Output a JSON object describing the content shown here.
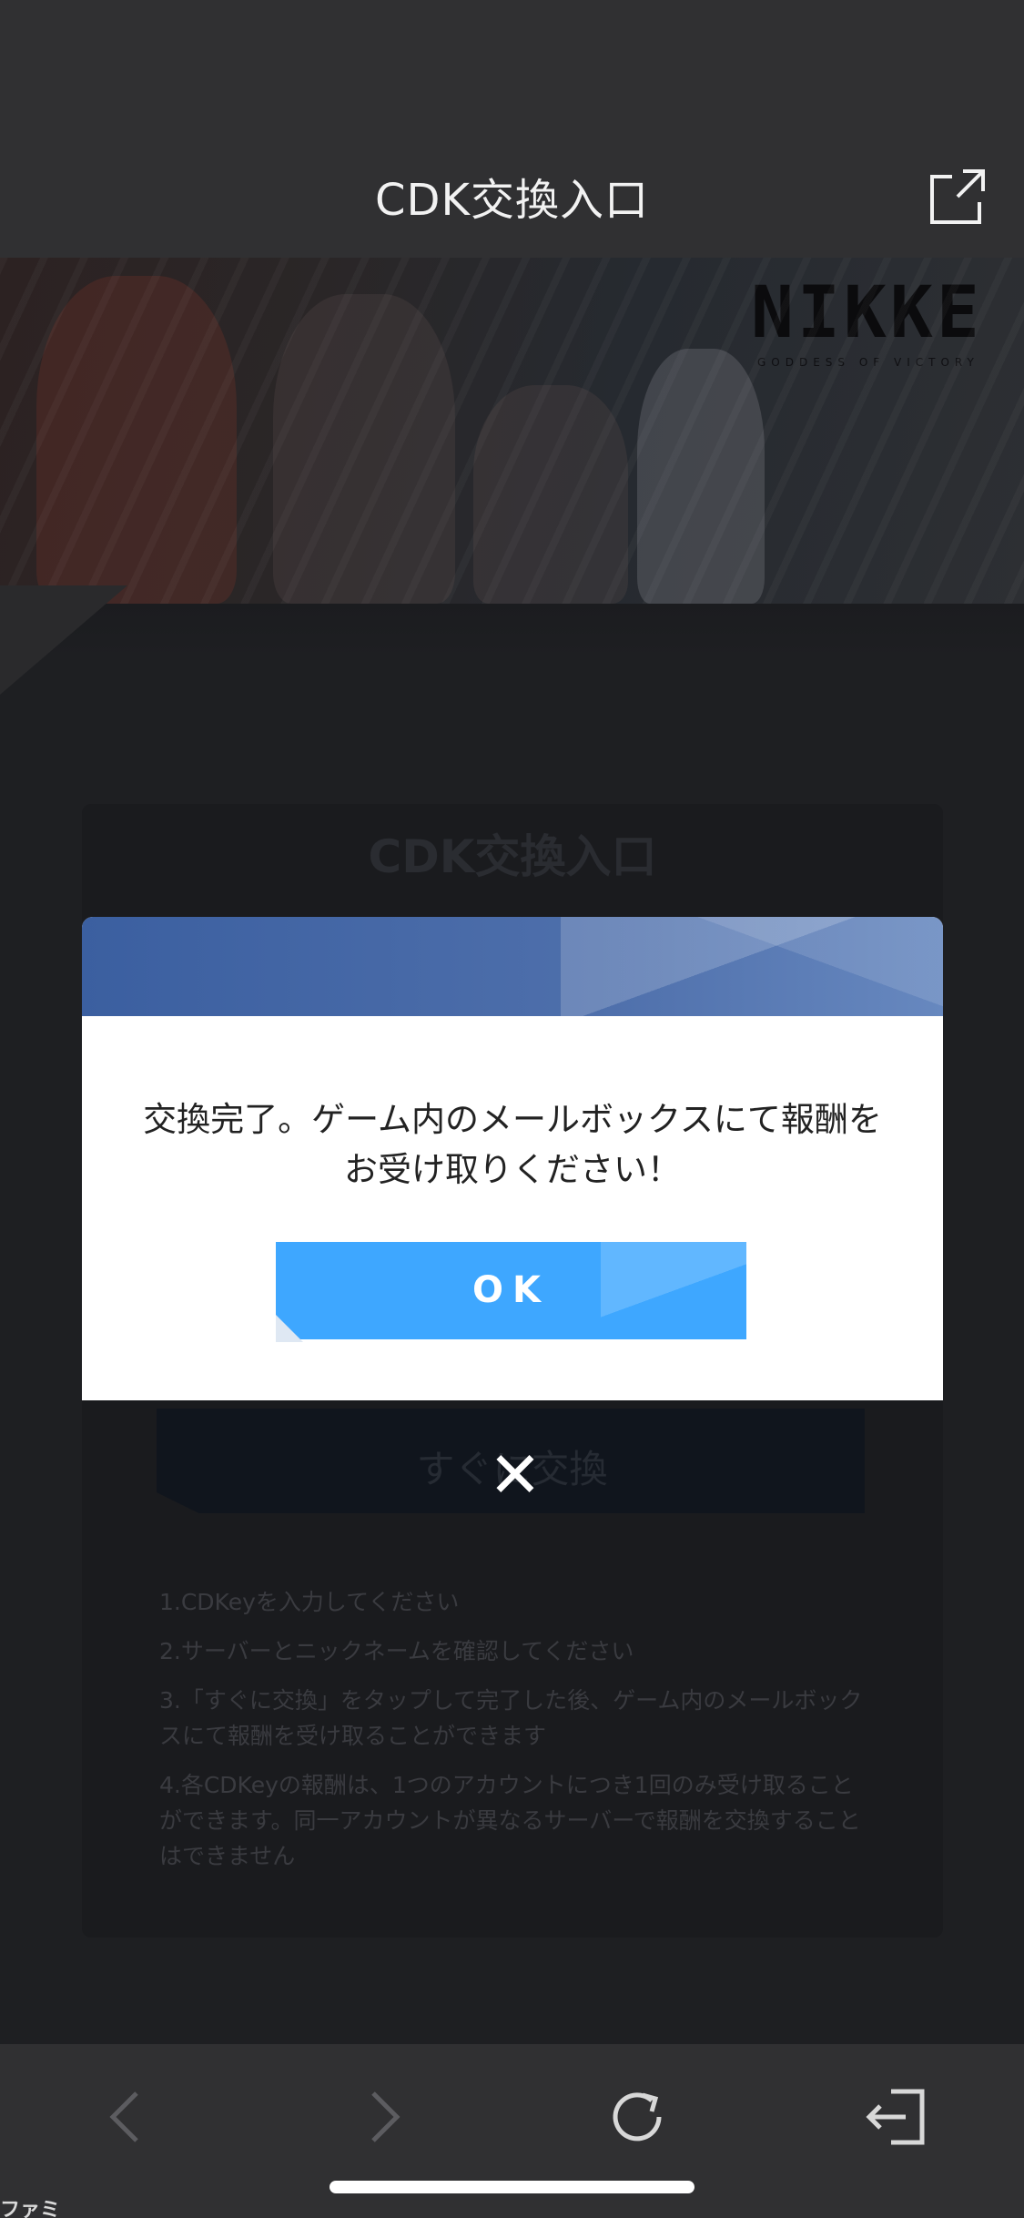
{
  "topbar": {
    "title": "CDK交換入口"
  },
  "banner": {
    "logo": "NIKKE",
    "logo_sub": "GODDESS OF VICTORY"
  },
  "card": {
    "title": "CDK交換入口",
    "exchange_button": "すぐに交換",
    "instructions": [
      "1.CDKeyを入力してください",
      "2.サーバーとニックネームを確認してください",
      "3.「すぐに交換」をタップして完了した後、ゲーム内のメールボックスにて報酬を受け取ることができます",
      "4.各CDKeyの報酬は、1つのアカウントにつき1回のみ受け取ることができます。同一アカウントが異なるサーバーで報酬を交換することはできません"
    ]
  },
  "modal": {
    "message_line1": "交換完了。ゲーム内のメールボックスにて報酬を",
    "message_line2": "お受け取りください！",
    "ok_label": "OK",
    "close_glyph": "✕"
  },
  "toolbar": {
    "icons": [
      "back-icon",
      "forward-icon",
      "refresh-icon",
      "exit-icon"
    ]
  },
  "watermark": "ファミ通.com",
  "colors": {
    "accent": "#3ea7ff",
    "modal_header": "#4e6fab",
    "bar": "#303032"
  }
}
